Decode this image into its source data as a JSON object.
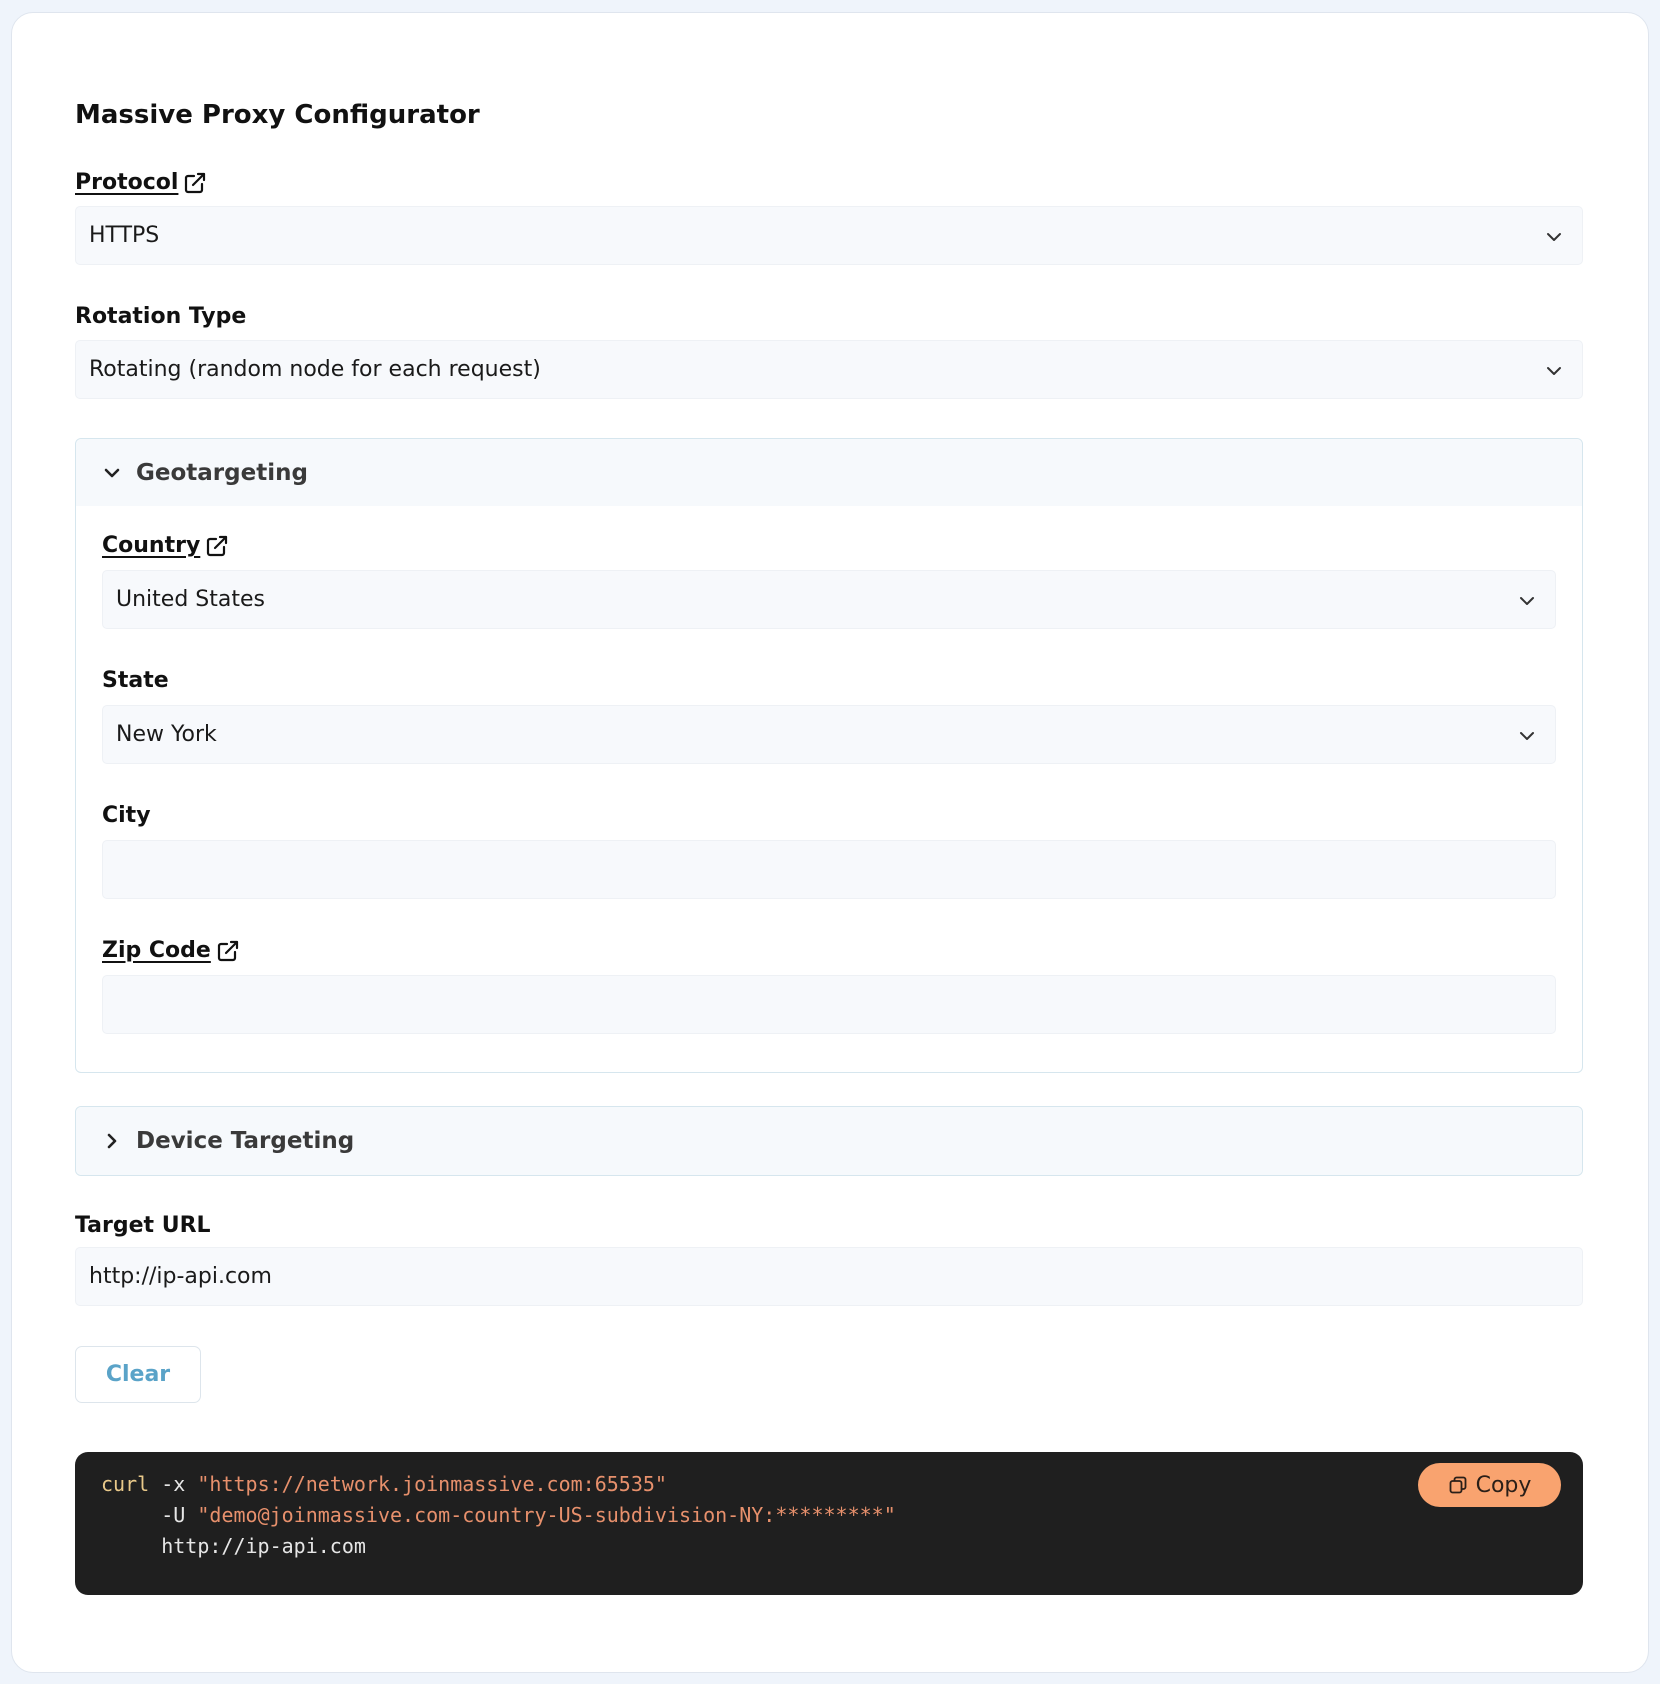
{
  "title": "Massive Proxy Configurator",
  "protocol": {
    "label": "Protocol",
    "value": "HTTPS"
  },
  "rotation": {
    "label": "Rotation Type",
    "value": "Rotating (random node for each request)"
  },
  "geotargeting": {
    "heading": "Geotargeting",
    "country": {
      "label": "Country",
      "value": "United States"
    },
    "state": {
      "label": "State",
      "value": "New York"
    },
    "city": {
      "label": "City",
      "value": ""
    },
    "zip": {
      "label": "Zip Code",
      "value": ""
    }
  },
  "device_targeting": {
    "heading": "Device Targeting"
  },
  "target_url": {
    "label": "Target URL",
    "value": "http://ip-api.com"
  },
  "clear_label": "Clear",
  "code": {
    "cmd": "curl",
    "flag_x": "-x",
    "proxy": "\"https://network.joinmassive.com:65535\"",
    "flag_u": "-U",
    "auth": "\"demo@joinmassive.com-country-US-subdivision-NY:*********\"",
    "url": "http://ip-api.com",
    "copy_label": "Copy"
  },
  "colors": {
    "accent": "#5aa3c8",
    "copy_button": "#f9a36f",
    "code_bg": "#1f1f1f"
  },
  "icons": [
    "external-link-icon",
    "chevron-down-icon",
    "chevron-right-icon",
    "copy-icon"
  ]
}
